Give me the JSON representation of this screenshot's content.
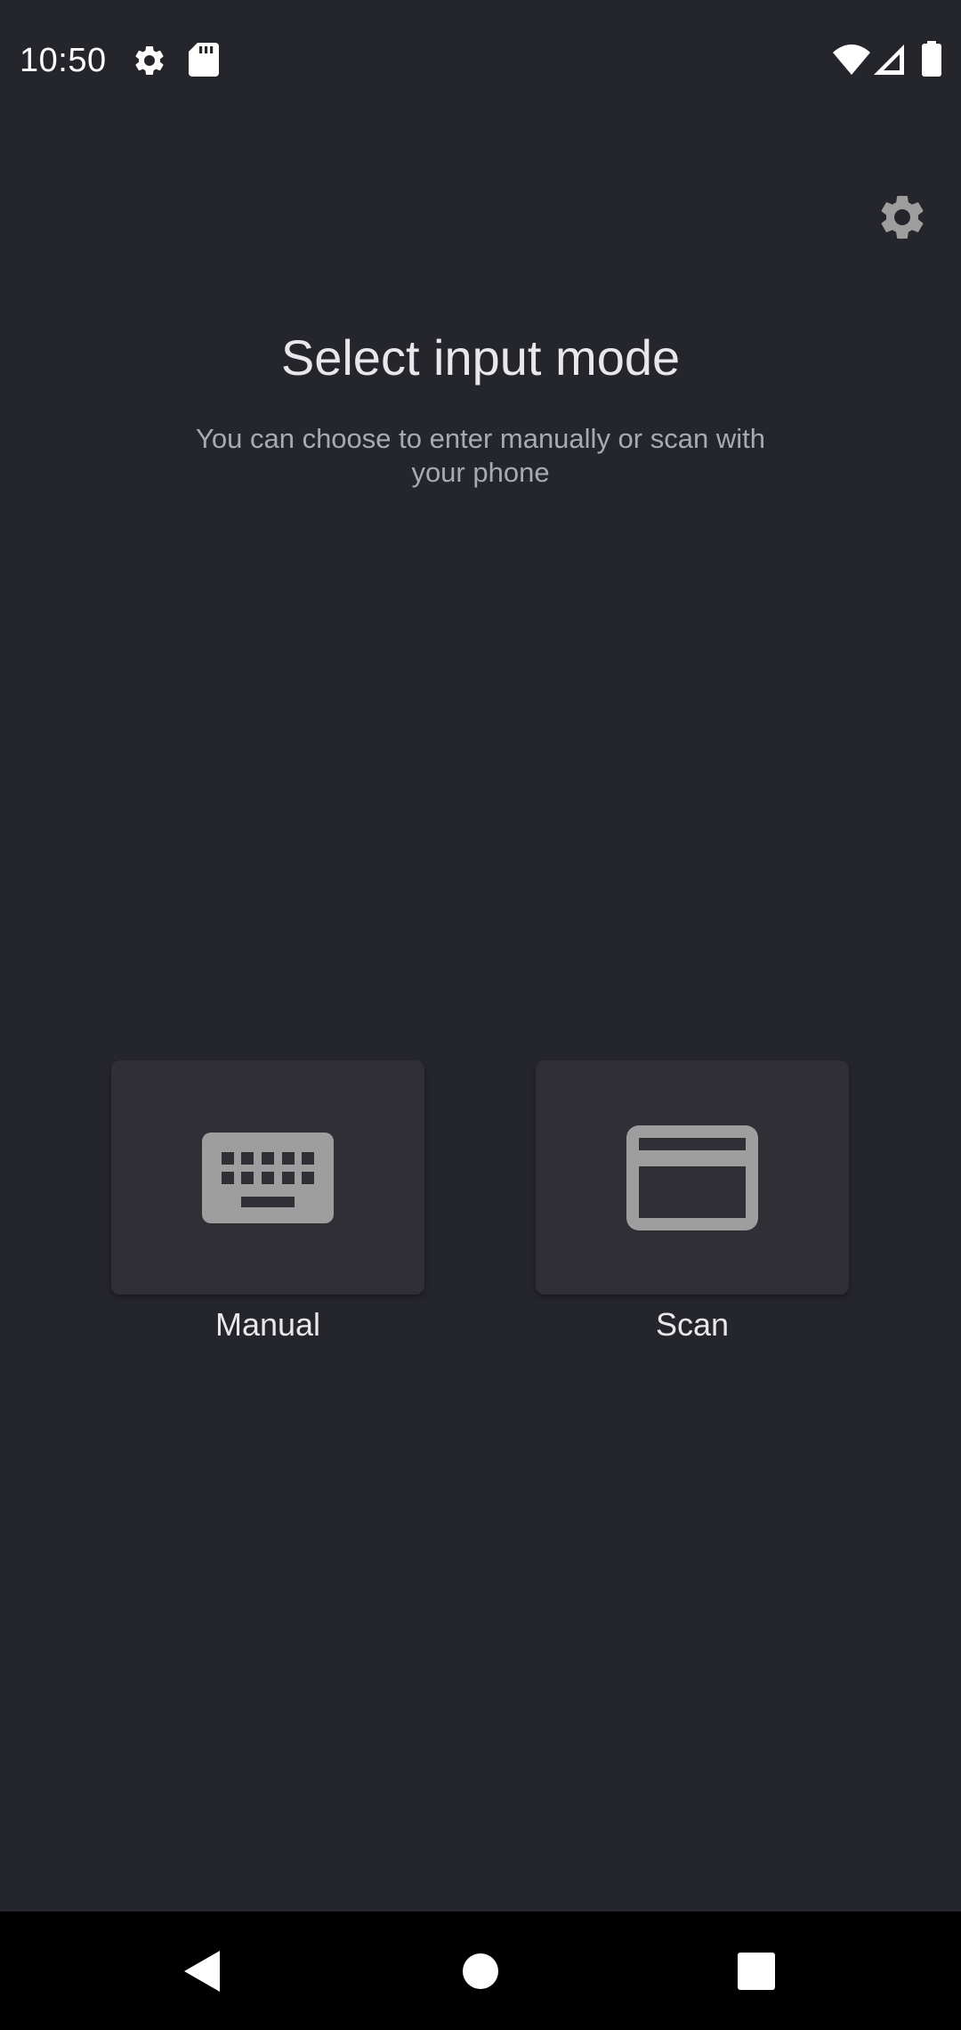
{
  "status_bar": {
    "time": "10:50",
    "icons": [
      "gear-icon",
      "sd-card-icon",
      "wifi-icon",
      "cell-signal-icon",
      "battery-icon"
    ]
  },
  "header": {
    "settings_icon": "gear-icon",
    "title": "Select input mode",
    "subtitle": "You can choose to enter manually or scan with your phone"
  },
  "modes": [
    {
      "label": "Manual",
      "icon": "keyboard-icon"
    },
    {
      "label": "Scan",
      "icon": "card-icon"
    }
  ],
  "nav_bar": {
    "buttons": [
      "back-icon",
      "home-icon",
      "recents-icon"
    ]
  },
  "colors": {
    "background": "#25252c",
    "card": "#2f2f35",
    "icon": "#9e9e9e",
    "text_primary": "#e8e8ec",
    "text_secondary": "#a9a9b2",
    "nav_bar": "#000000"
  }
}
